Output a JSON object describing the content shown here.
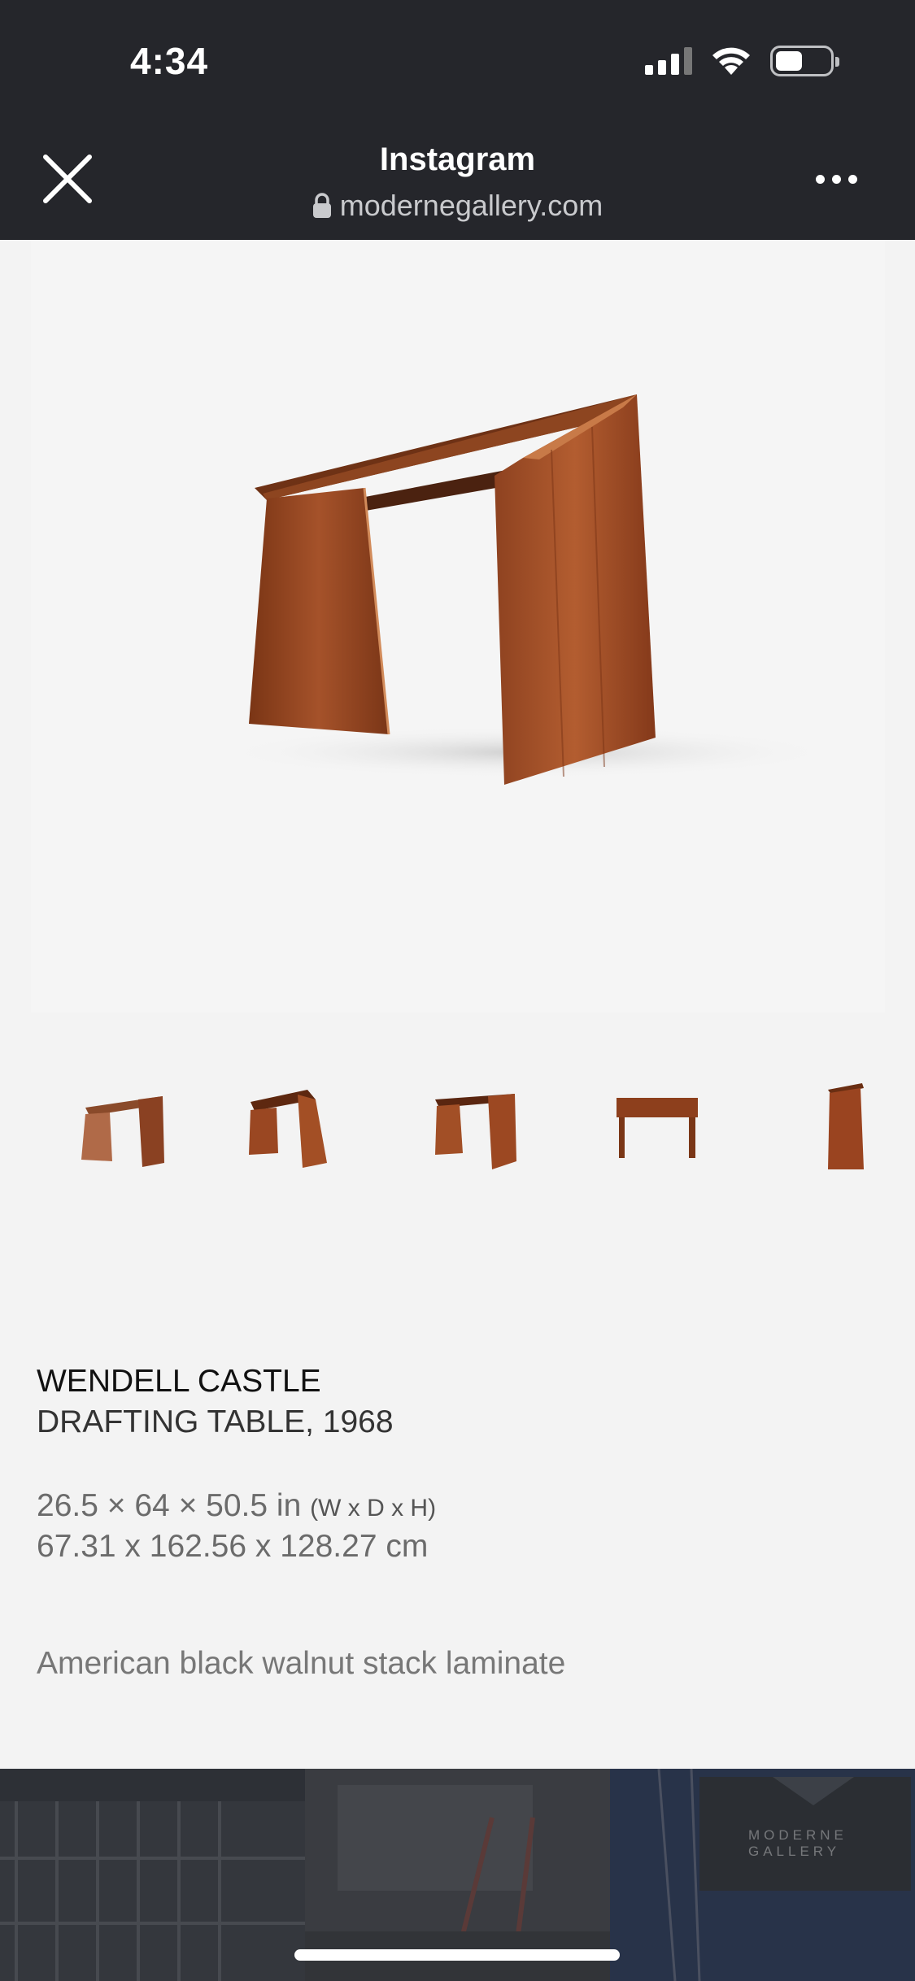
{
  "status": {
    "time": "4:34"
  },
  "header": {
    "title": "Instagram",
    "url": "modernegallery.com"
  },
  "product": {
    "artist": "WENDELL CASTLE",
    "title": "DRAFTING TABLE, 1968",
    "dimensions_in": "26.5 × 64 × 50.5 in",
    "dimensions_unit": "(W x D x H)",
    "dimensions_cm": "67.31 x 162.56 x 128.27 cm",
    "material": "American black walnut stack laminate"
  },
  "thumbnails": [
    {
      "icon": "table-angle-1-thumbnail"
    },
    {
      "icon": "table-angle-2-thumbnail"
    },
    {
      "icon": "table-angle-3-thumbnail"
    },
    {
      "icon": "table-front-thumbnail"
    },
    {
      "icon": "table-side-thumbnail"
    }
  ],
  "footer": {
    "gallery_sign": "MODERNE GALLERY"
  },
  "colors": {
    "header_bg": "#25262b",
    "page_bg": "#f3f3f3",
    "wood": "#9a4a22",
    "wood_dark": "#6e3014"
  }
}
